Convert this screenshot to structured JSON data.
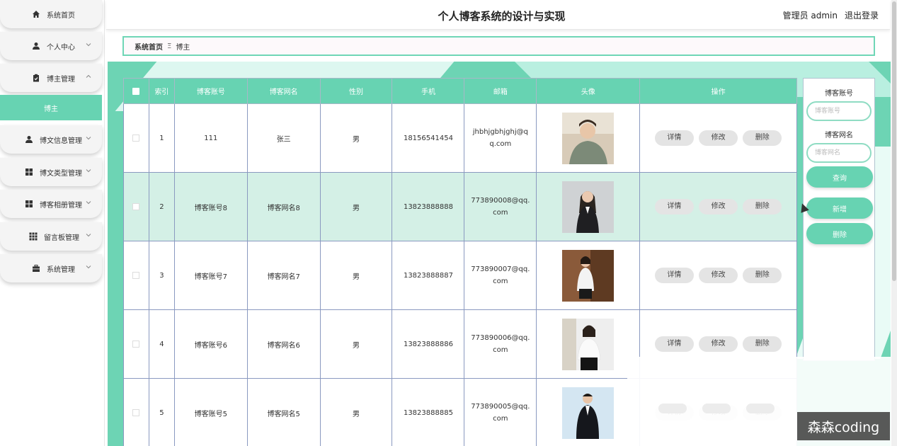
{
  "header": {
    "title": "个人博客系统的设计与实现",
    "user": "管理员 admin",
    "logout": "退出登录"
  },
  "sidebar": {
    "items": [
      {
        "label": "系统首页",
        "icon": "home-icon"
      },
      {
        "label": "个人中心",
        "icon": "user-icon"
      },
      {
        "label": "博主管理",
        "icon": "clipboard-icon"
      },
      {
        "label": "博文信息管理",
        "icon": "user-icon"
      },
      {
        "label": "博文类型管理",
        "icon": "grid-icon"
      },
      {
        "label": "博客相册管理",
        "icon": "grid-icon"
      },
      {
        "label": "留言板管理",
        "icon": "apps-icon"
      },
      {
        "label": "系统管理",
        "icon": "briefcase-icon"
      }
    ],
    "sub_active": "博主"
  },
  "breadcrumb": {
    "home": "系统首页",
    "separator": "Ξ",
    "current": "博主"
  },
  "table": {
    "headers": [
      "索引",
      "博客账号",
      "博客网名",
      "性别",
      "手机",
      "邮箱",
      "头像",
      "操作"
    ],
    "rows": [
      {
        "index": "1",
        "account": "111",
        "name": "张三",
        "gender": "男",
        "phone": "18156541454",
        "email": "jhbhjgbhjghj@qq.com"
      },
      {
        "index": "2",
        "account": "博客账号8",
        "name": "博客网名8",
        "gender": "男",
        "phone": "13823888888",
        "email": "773890008@qq.com"
      },
      {
        "index": "3",
        "account": "博客账号7",
        "name": "博客网名7",
        "gender": "男",
        "phone": "13823888887",
        "email": "773890007@qq.com"
      },
      {
        "index": "4",
        "account": "博客账号6",
        "name": "博客网名6",
        "gender": "男",
        "phone": "13823888886",
        "email": "773890006@qq.com"
      },
      {
        "index": "5",
        "account": "博客账号5",
        "name": "博客网名5",
        "gender": "男",
        "phone": "13823888885",
        "email": "773890005@qq.com"
      }
    ],
    "actions": [
      "详情",
      "修改",
      "删除"
    ]
  },
  "search": {
    "account_label": "博客账号",
    "account_placeholder": "博客账号",
    "name_label": "博客网名",
    "name_placeholder": "博客网名",
    "query_btn": "查询",
    "add_btn": "新增",
    "delete_btn": "删除"
  },
  "watermark": "森森coding",
  "colors": {
    "accent": "#67d3b2",
    "highlight_row": "#d4f0e6"
  }
}
